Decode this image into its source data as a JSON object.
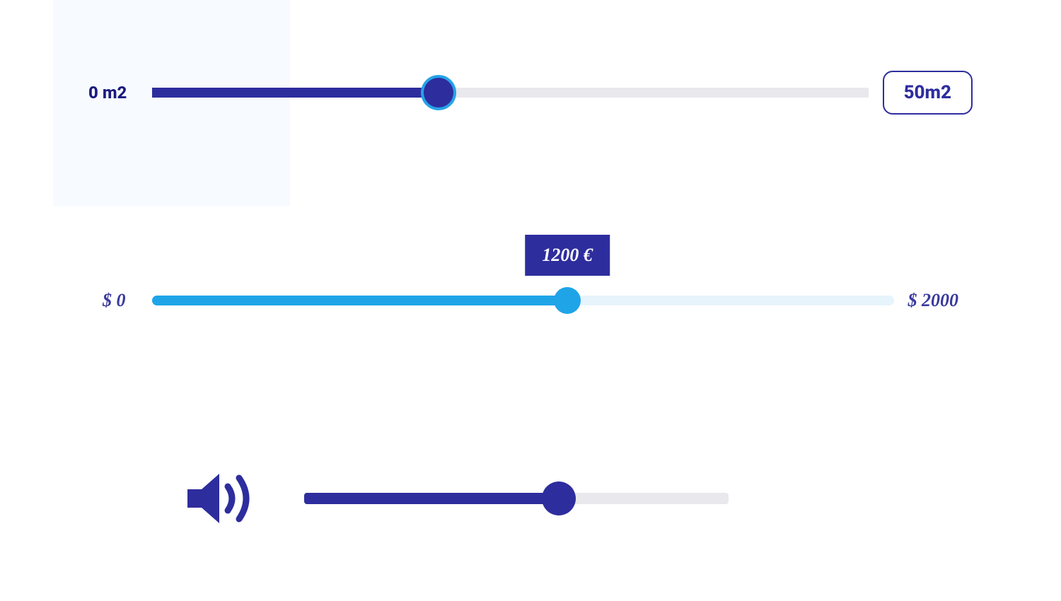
{
  "slider_area": {
    "min_label": "0 m2",
    "value_label": "50m2",
    "fill_percent": 40
  },
  "slider_price": {
    "min_label": "$ 0",
    "max_label": "$ 2000",
    "tooltip": "1200 €",
    "fill_percent": 56
  },
  "slider_volume": {
    "fill_percent": 60
  }
}
